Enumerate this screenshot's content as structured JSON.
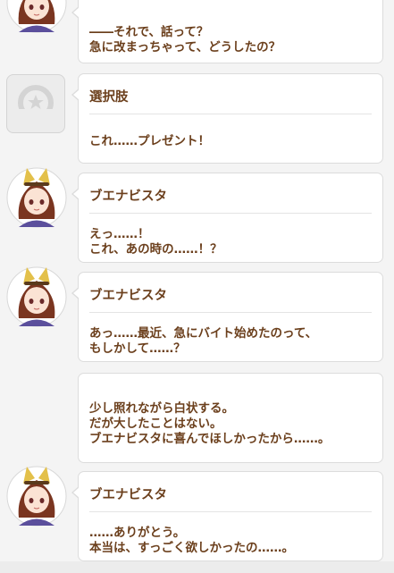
{
  "messages": [
    {
      "speaker": "",
      "lines": [
        "――それで、話って？",
        "急に改まっちゃって、どうしたの？"
      ]
    },
    {
      "speaker": "選択肢",
      "lines": [
        "これ……プレゼント！"
      ]
    },
    {
      "speaker": "ブエナビスタ",
      "lines": [
        "えっ……！",
        "これ、あの時の……！？"
      ]
    },
    {
      "speaker": "ブエナビスタ",
      "lines": [
        "あっ……最近、急にバイト始めたのって、",
        "もしかして……？"
      ]
    },
    {
      "speaker": "",
      "lines": [
        "少し照れながら白状する。",
        "だが大したことはない。",
        "ブエナビスタに喜んでほしかったから……。"
      ]
    },
    {
      "speaker": "ブエナビスタ",
      "lines": [
        "……ありがとう。",
        "本当は、すっごく欲しかったの……。"
      ]
    }
  ],
  "colors": {
    "text": "#6b3f1c",
    "hair": "#7a3520",
    "ear": "#e3c04a",
    "uniform": "#5b4f9c"
  }
}
